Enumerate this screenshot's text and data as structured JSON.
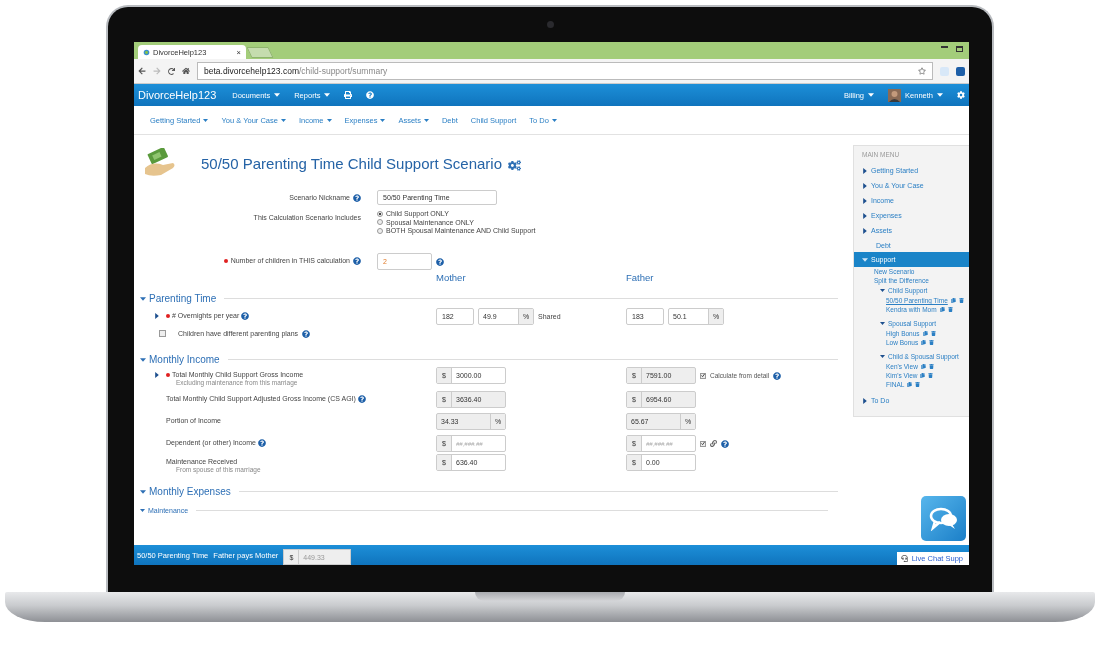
{
  "browser": {
    "tab_title": "DivorceHelp123",
    "tab_close": "×",
    "url_host": "beta.divorcehelp123.com",
    "url_path": "/child-support/summary"
  },
  "navbar": {
    "brand": "DivorceHelp123",
    "menus": [
      {
        "label": "Documents",
        "kind": "dropdown"
      },
      {
        "label": "Reports",
        "kind": "dropdown"
      },
      {
        "kind": "print"
      },
      {
        "kind": "help"
      }
    ],
    "right_menus": [
      {
        "label": "Billing",
        "kind": "dropdown"
      },
      {
        "label": "Kenneth",
        "kind": "user"
      },
      {
        "kind": "settings"
      }
    ]
  },
  "subnav": [
    {
      "label": "Getting Started",
      "dropdown": true
    },
    {
      "label": "You & Your Case",
      "dropdown": true
    },
    {
      "label": "Income",
      "dropdown": true
    },
    {
      "label": "Expenses",
      "dropdown": true
    },
    {
      "label": "Assets",
      "dropdown": true
    },
    {
      "label": "Debt",
      "dropdown": false
    },
    {
      "label": "Child Support",
      "dropdown": false
    },
    {
      "label": "To Do",
      "dropdown": true
    }
  ],
  "title": "50/50 Parenting Time Child Support Scenario",
  "nickname": {
    "label": "Scenario Nickname",
    "help": true,
    "value": "50/50 Parenting Time"
  },
  "includes": {
    "label": "This Calculation Scenario Includes",
    "options": [
      {
        "label": "Child Support ONLY",
        "selected": true
      },
      {
        "label": "Spousal Maintenance ONLY",
        "selected": false
      },
      {
        "label": "BOTH Spousal Maintenance AND Child Support",
        "selected": false
      }
    ]
  },
  "children_count": {
    "label": "Number of children in THIS calculation",
    "required": true,
    "help": true,
    "value": "2"
  },
  "columns": [
    "Mother",
    "Father"
  ],
  "sections": [
    {
      "title": "Parenting Time",
      "expanded": true,
      "rows": [
        {
          "kind": "overnights",
          "label": "# Overnights per year",
          "expanded": false,
          "required": true,
          "help": true,
          "mother": {
            "nights": "182",
            "percent": "49.9",
            "unit": "%"
          },
          "shared": "Shared",
          "father": {
            "nights": "183",
            "percent": "50.1",
            "unit": "%"
          }
        },
        {
          "kind": "checkbox",
          "label": "Children have different parenting plans",
          "checked": false,
          "help": true
        }
      ]
    },
    {
      "title": "Monthly Income",
      "expanded": true,
      "rows": [
        {
          "kind": "money",
          "label": "Total Monthly Child Support Gross Income",
          "note": "Excluding maintenance from this marriage",
          "expanded": false,
          "required": true,
          "help": false,
          "mother": {
            "unit": "$",
            "value": "3000.00",
            "readonly": false
          },
          "father": {
            "unit": "$",
            "value": "7591.00",
            "readonly": true
          },
          "extra": {
            "kind": "calc",
            "label": "Calculate from detail",
            "checked": true,
            "help": true
          }
        },
        {
          "kind": "money",
          "label": "Total Monthly Child Support Adjusted Gross Income (CS AGI)",
          "help": true,
          "mother": {
            "unit": "$",
            "value": "3636.40",
            "readonly": true
          },
          "father": {
            "unit": "$",
            "value": "6954.60",
            "readonly": true
          }
        },
        {
          "kind": "percent",
          "label": "Portion of Income",
          "help": false,
          "mother": {
            "unit": "%",
            "value": "34.33",
            "readonly": true
          },
          "father": {
            "unit": "%",
            "value": "65.67",
            "readonly": true
          }
        },
        {
          "kind": "money",
          "label": "Dependent (or other) Income",
          "help": true,
          "mother": {
            "unit": "$",
            "placeholder": "##,###.##",
            "readonly": false
          },
          "father": {
            "unit": "$",
            "placeholder": "##,###.##",
            "readonly": false
          },
          "extra": {
            "kind": "link",
            "checked": true,
            "help": true
          }
        },
        {
          "kind": "money",
          "label": "Maintenance Received",
          "note": "From spouse of this marriage",
          "help": false,
          "mother": {
            "unit": "$",
            "value": "636.40",
            "readonly": false
          },
          "father": {
            "unit": "$",
            "value": "0.00",
            "readonly": false
          }
        }
      ]
    },
    {
      "title": "Monthly Expenses",
      "expanded": true,
      "rows": [
        {
          "kind": "subsection",
          "label": "Maintenance",
          "expanded": true
        }
      ]
    }
  ],
  "sidebar": {
    "heading": "MAIN MENU",
    "items": [
      {
        "label": "Getting Started",
        "kind": "section",
        "expanded": false,
        "selected": false
      },
      {
        "label": "You & Your Case",
        "kind": "section",
        "expanded": false,
        "selected": false
      },
      {
        "label": "Income",
        "kind": "section",
        "expanded": false,
        "selected": false
      },
      {
        "label": "Expenses",
        "kind": "section",
        "expanded": false,
        "selected": false
      },
      {
        "label": "Assets",
        "kind": "section",
        "expanded": false,
        "selected": false
      },
      {
        "label": "Debt",
        "kind": "plain",
        "selected": false
      },
      {
        "label": "Support",
        "kind": "section",
        "expanded": true,
        "selected": true,
        "children": [
          {
            "label": "New Scenario",
            "kind": "link",
            "selected": false
          },
          {
            "label": "Split the Difference",
            "kind": "link",
            "selected": false
          },
          {
            "label": "Child Support",
            "kind": "group",
            "expanded": true,
            "selected": false,
            "children": [
              {
                "label": "50/50 Parenting Time",
                "kind": "scenario",
                "selected": true
              },
              {
                "label": "Kendra with Mom",
                "kind": "scenario",
                "selected": false
              }
            ]
          },
          {
            "label": "Spousal Support",
            "kind": "group",
            "expanded": true,
            "selected": false,
            "children": [
              {
                "label": "High Bonus",
                "kind": "scenario",
                "selected": false
              },
              {
                "label": "Low Bonus",
                "kind": "scenario",
                "selected": false
              }
            ]
          },
          {
            "label": "Child & Spousal Support",
            "kind": "group",
            "expanded": true,
            "selected": false,
            "children": [
              {
                "label": "Ken's View",
                "kind": "scenario",
                "selected": false
              },
              {
                "label": "Kim's View",
                "kind": "scenario",
                "selected": false
              },
              {
                "label": "FINAL",
                "kind": "scenario",
                "selected": false
              }
            ]
          }
        ]
      },
      {
        "label": "To Do",
        "kind": "section",
        "expanded": false,
        "selected": false
      }
    ]
  },
  "footer": {
    "scenario": "50/50 Parenting Time",
    "direction": "Father pays Mother",
    "unit": "$",
    "amount": "449.33",
    "chat": "Live Chat Supp"
  }
}
